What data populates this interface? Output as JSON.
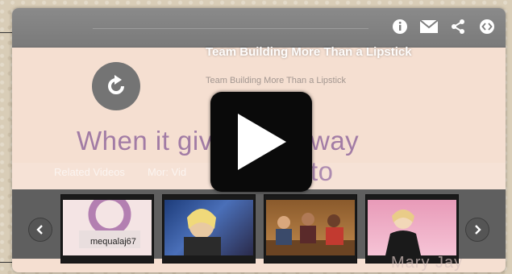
{
  "video": {
    "title": "Team Building More Than a Lipstick",
    "subtitle": "Team Building More Than a Lipstick",
    "caption_left": "When it give",
    "caption_right": "way to"
  },
  "related": {
    "tabs": [
      "Related Videos",
      "Mor: Vid"
    ],
    "thumbnails": [
      {
        "label": "mequalaj67"
      },
      {
        "label": ""
      },
      {
        "label": ""
      },
      {
        "label": ""
      }
    ]
  },
  "watermark": "Mary Jay",
  "icons": {
    "info": "info-icon",
    "email": "envelope-icon",
    "share": "share-icon",
    "embed": "embed-icon",
    "replay": "replay-icon",
    "play": "play-icon",
    "prev": "chevron-left-icon",
    "next": "chevron-right-icon"
  },
  "colors": {
    "panel_bg": "#f5dfd1",
    "toolbar": "#808080",
    "caption_text": "#a27ca5",
    "play_button": "#0a0a0a"
  }
}
